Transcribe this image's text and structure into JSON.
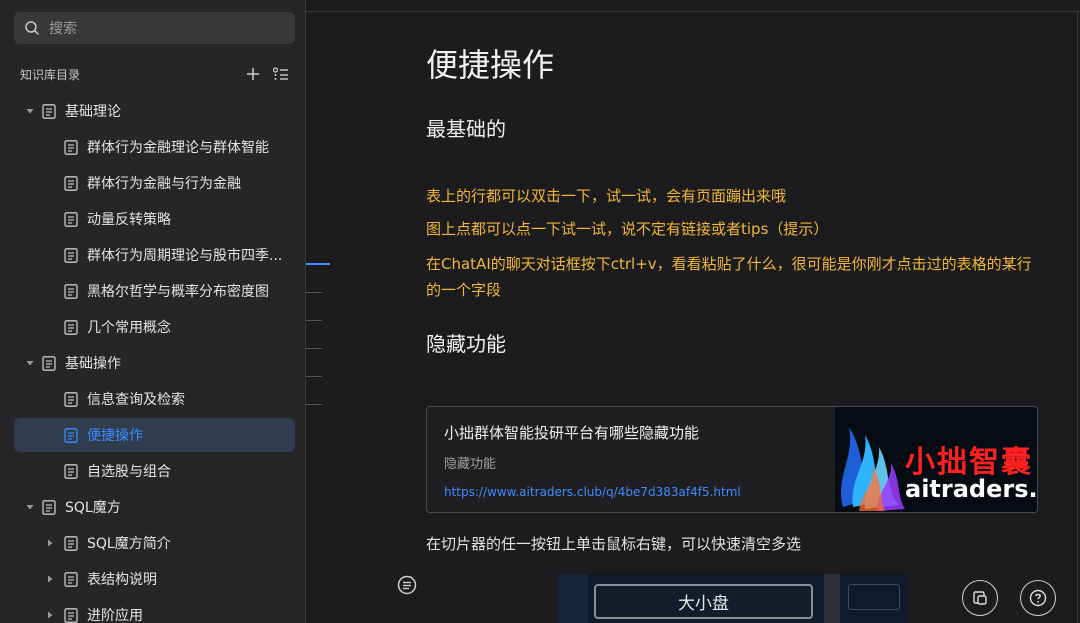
{
  "sidebar": {
    "search_placeholder": "搜索",
    "kb_title": "知识库目录",
    "items": [
      {
        "label": "基础理论",
        "level": 0,
        "expanded": true
      },
      {
        "label": "群体行为金融理论与群体智能",
        "level": 1
      },
      {
        "label": "群体行为金融与行为金融",
        "level": 1
      },
      {
        "label": "动量反转策略",
        "level": 1
      },
      {
        "label": "群体行为周期理论与股市四季...",
        "level": 1
      },
      {
        "label": "黑格尔哲学与概率分布密度图",
        "level": 1
      },
      {
        "label": "几个常用概念",
        "level": 1
      },
      {
        "label": "基础操作",
        "level": 0,
        "expanded": true
      },
      {
        "label": "信息查询及检索",
        "level": 1
      },
      {
        "label": "便捷操作",
        "level": 1,
        "selected": true
      },
      {
        "label": "自选股与组合",
        "level": 1
      },
      {
        "label": "SQL魔方",
        "level": 0,
        "expanded": true
      },
      {
        "label": "SQL魔方简介",
        "level": 1,
        "collapsible": true
      },
      {
        "label": "表结构说明",
        "level": 1,
        "collapsible": true
      },
      {
        "label": "进阶应用",
        "level": 1,
        "collapsible": true
      }
    ]
  },
  "content": {
    "title": "便捷操作",
    "section1": "最基础的",
    "tips": [
      "表上的行都可以双击一下，试一试，会有页面蹦出来哦",
      "图上点都可以点一下试一试，说不定有链接或者tips（提示）",
      "在ChatAI的聊天对话框按下ctrl+v，看看粘贴了什么，很可能是你刚才点击过的表格的某行的一个字段"
    ],
    "section2": "隐藏功能",
    "card": {
      "title": "小拙群体智能投研平台有哪些隐藏功能",
      "subtitle": "隐藏功能",
      "url": "https://www.aitraders.club/q/4be7d383af4f5.html",
      "logo_cn": "小拙智囊",
      "logo_en": "aitraders.club"
    },
    "paragraph": "在切片器的任一按钮上单击鼠标右键，可以快速清空多选",
    "screenshot_button": "大小盘"
  },
  "colors": {
    "accent": "#3d8bff",
    "tip": "#f0b73a",
    "selected_bg": "#2f3d4e"
  },
  "icons": {
    "search": "search-icon",
    "add": "plus-icon",
    "list": "list-icon",
    "doc": "document-icon",
    "toc": "toc-icon",
    "feedback": "feedback-icon",
    "help": "help-icon"
  }
}
